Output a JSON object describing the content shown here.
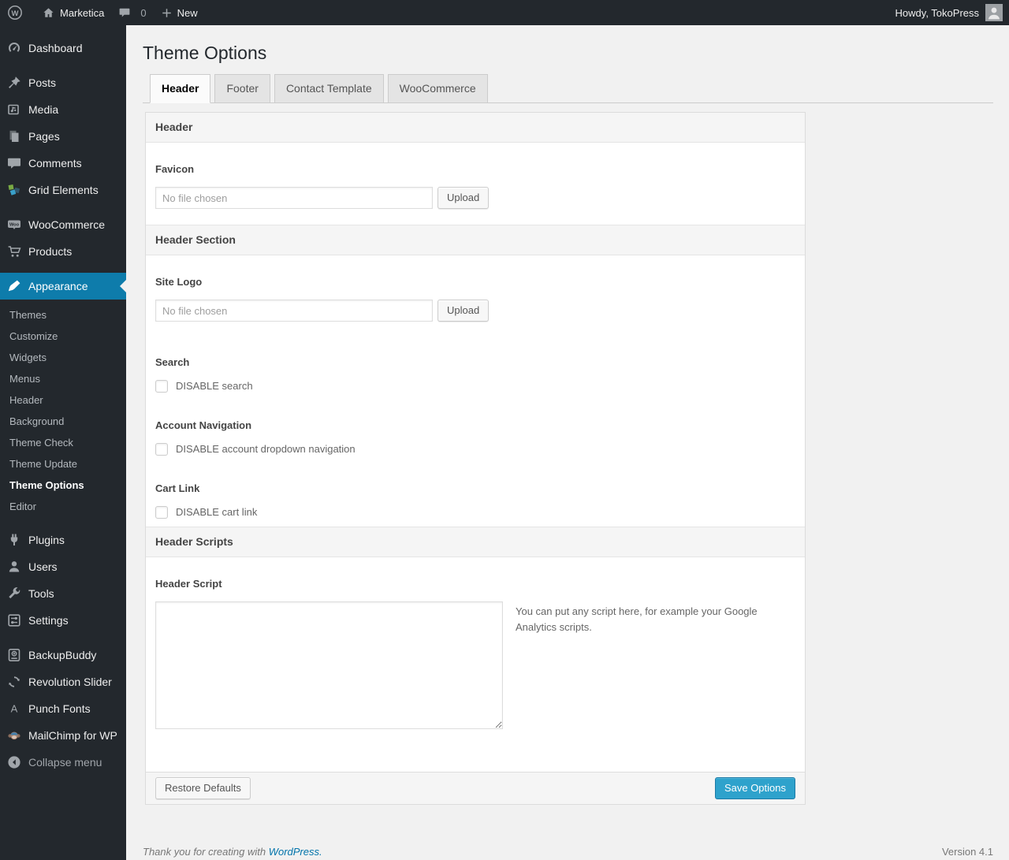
{
  "admin_bar": {
    "site_name": "Marketica",
    "comment_count": "0",
    "new_label": "New",
    "howdy": "Howdy, TokoPress",
    "wp_logo_glyph": "W"
  },
  "sidebar": {
    "items": [
      {
        "label": "Dashboard",
        "icon": "dashboard-icon"
      },
      {
        "label": "Posts",
        "icon": "pin-icon"
      },
      {
        "label": "Media",
        "icon": "media-icon"
      },
      {
        "label": "Pages",
        "icon": "pages-icon"
      },
      {
        "label": "Comments",
        "icon": "comments-icon"
      },
      {
        "label": "Grid Elements",
        "icon": "grid-elements-icon"
      },
      {
        "label": "WooCommerce",
        "icon": "woocommerce-badge-icon",
        "badge_glyph": "Woo"
      },
      {
        "label": "Products",
        "icon": "cart-icon"
      },
      {
        "label": "Appearance",
        "icon": "paintbrush-icon",
        "current": true
      },
      {
        "label": "Plugins",
        "icon": "plugin-icon"
      },
      {
        "label": "Users",
        "icon": "users-icon"
      },
      {
        "label": "Tools",
        "icon": "wrench-icon"
      },
      {
        "label": "Settings",
        "icon": "settings-icon"
      },
      {
        "label": "BackupBuddy",
        "icon": "backup-icon"
      },
      {
        "label": "Revolution Slider",
        "icon": "refresh-icon"
      },
      {
        "label": "Punch Fonts",
        "icon": "letter-a-icon",
        "letter_glyph": "A"
      },
      {
        "label": "MailChimp for WP",
        "icon": "monkey-icon"
      },
      {
        "label": "Collapse menu",
        "icon": "collapse-icon"
      }
    ],
    "submenu": {
      "items": [
        {
          "label": "Themes"
        },
        {
          "label": "Customize"
        },
        {
          "label": "Widgets"
        },
        {
          "label": "Menus"
        },
        {
          "label": "Header"
        },
        {
          "label": "Background"
        },
        {
          "label": "Theme Check"
        },
        {
          "label": "Theme Update"
        },
        {
          "label": "Theme Options",
          "current": true
        },
        {
          "label": "Editor"
        }
      ]
    }
  },
  "main": {
    "page_title": "Theme Options",
    "tabs": [
      {
        "label": "Header",
        "active": true
      },
      {
        "label": "Footer",
        "active": false
      },
      {
        "label": "Contact Template",
        "active": false
      },
      {
        "label": "WooCommerce",
        "active": false
      }
    ],
    "section_header": {
      "title": "Header",
      "favicon": {
        "label": "Favicon",
        "placeholder": "No file chosen",
        "upload_label": "Upload"
      }
    },
    "section_header_section": {
      "title": "Header Section",
      "site_logo": {
        "label": "Site Logo",
        "placeholder": "No file chosen",
        "upload_label": "Upload"
      },
      "search": {
        "label": "Search",
        "checkbox_label": "DISABLE search",
        "checked": false
      },
      "account_navigation": {
        "label": "Account Navigation",
        "checkbox_label": "DISABLE account dropdown navigation",
        "checked": false
      },
      "cart_link": {
        "label": "Cart Link",
        "checkbox_label": "DISABLE cart link",
        "checked": false
      }
    },
    "section_header_scripts": {
      "title": "Header Scripts",
      "header_script": {
        "label": "Header Script",
        "textarea_value": "",
        "help": "You can put any script here, for example your Google Analytics scripts."
      }
    },
    "footer_bar": {
      "restore_label": "Restore Defaults",
      "save_label": "Save Options"
    }
  },
  "page_footer": {
    "thanks_text": "Thank you for creating with ",
    "wordpress_link": "WordPress.",
    "version": "Version 4.1"
  },
  "colors": {
    "admin_dark": "#23282d",
    "menu_highlight": "#0e7cab",
    "button_primary": "#2ea2cc",
    "button_primary_border": "#1b7aa6",
    "link": "#0073aa",
    "page_background": "#f1f1f1"
  }
}
